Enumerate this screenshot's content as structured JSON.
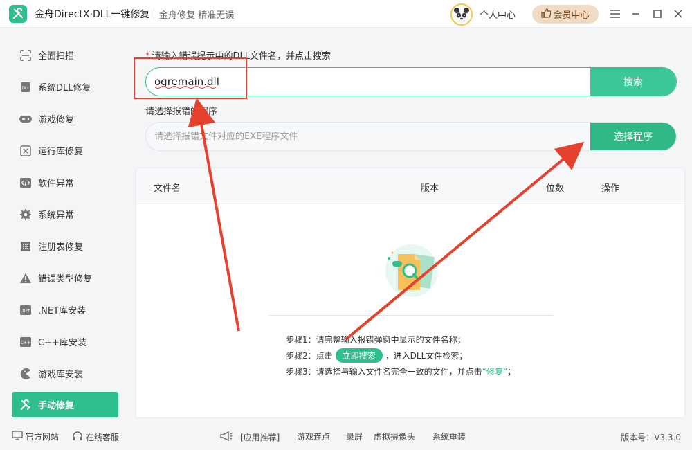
{
  "titlebar": {
    "app_title": "金舟DirectX·DLL一键修复",
    "slogan": "金舟修复 精准无误",
    "personal_center": "个人中心",
    "vip_center": "会员中心"
  },
  "sidebar": {
    "items": [
      {
        "label": "全面扫描",
        "icon": "scan-icon"
      },
      {
        "label": "系统DLL修复",
        "icon": "dll-icon"
      },
      {
        "label": "游戏修复",
        "icon": "gamepad-icon"
      },
      {
        "label": "运行库修复",
        "icon": "runtime-icon"
      },
      {
        "label": "软件异常",
        "icon": "code-icon"
      },
      {
        "label": "系统异常",
        "icon": "gear-icon"
      },
      {
        "label": "注册表修复",
        "icon": "list-icon"
      },
      {
        "label": "错误类型修复",
        "icon": "warning-icon"
      },
      {
        "label": ".NET库安装",
        "icon": "dotnet-icon"
      },
      {
        "label": "C++库安装",
        "icon": "cpp-icon"
      },
      {
        "label": "游戏库安装",
        "icon": "pacman-icon"
      },
      {
        "label": "手动修复",
        "icon": "tools-icon",
        "active": true
      }
    ]
  },
  "main": {
    "dll_label_star": "*",
    "dll_label": "请输入错误提示中的DLL文件名，并点击搜索",
    "dll_input_value": "ogremain.dll",
    "search_button": "搜索",
    "program_label": "请选择报错的程序",
    "program_placeholder": "请选择报错文件对应的EXE程序文件",
    "select_program_button": "选择程序",
    "table_headers": {
      "filename": "文件名",
      "version": "版本",
      "bits": "位数",
      "action": "操作"
    },
    "steps": {
      "step1": "步骤1：请完整输入报错弹窗中显示的文件名称；",
      "step2_prefix": "步骤2：点击",
      "step2_button": "立即搜索",
      "step2_suffix": "，进入DLL文件检索；",
      "step3_prefix": "步骤3：请选择与输入文件名完全一致的文件，并点击",
      "step3_quote": "“修复”",
      "step3_suffix": "；"
    }
  },
  "footer": {
    "official_site": "官方网站",
    "online_service": "在线客服",
    "app_recommend": "[应用推荐]",
    "links": [
      "游戏连点",
      "录屏",
      "虚拟摄像头",
      "系统重装"
    ],
    "version": "版本号：V3.3.0"
  },
  "colors": {
    "accent": "#2fbf8f",
    "annotation": "#e4412f",
    "vip_bg": "#f1dcc3"
  }
}
